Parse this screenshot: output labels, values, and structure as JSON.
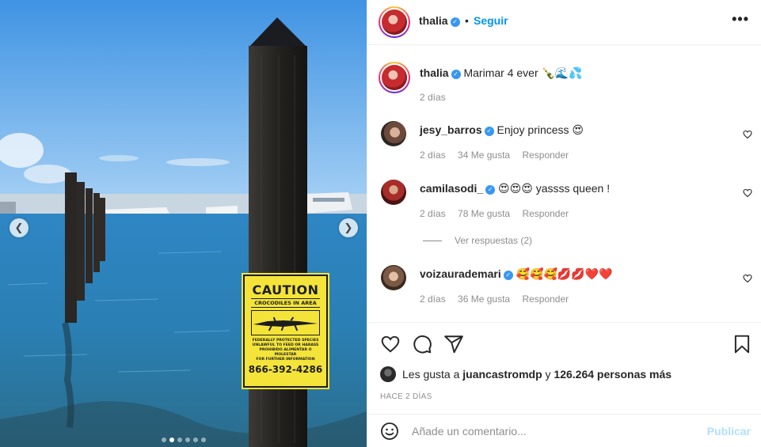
{
  "post": {
    "author": "thalia",
    "follow_label": "Seguir",
    "separator": "•",
    "more_label": "•••",
    "caption": {
      "username": "thalia",
      "text": "Marimar 4 ever 🍾🌊💦",
      "time": "2 días"
    }
  },
  "photo": {
    "sign": {
      "title": "CAUTION",
      "subtitle": "CROCODILES IN AREA",
      "line1": "FEDERALLY PROTECTED SPECIES",
      "line2": "UNLAWFUL TO FEED OR HARASS",
      "line3": "PROHIBIDO ALIMENTAR O MOLESTAR",
      "line4": "FOR FURTHER INFORMATION",
      "phone": "866-392-4286"
    },
    "carousel_count": 6,
    "carousel_active": 1
  },
  "comments": [
    {
      "username": "jesy_barros",
      "text": "Enjoy princess 😍",
      "time": "2 días",
      "likes": "34 Me gusta",
      "reply": "Responder"
    },
    {
      "username": "camilasodi_",
      "text": "😍😍😍 yassss queen !",
      "time": "2 días",
      "likes": "78 Me gusta",
      "reply": "Responder"
    },
    {
      "username": "voizaurademari",
      "text": "🥰🥰🥰💋💋❤️❤️",
      "time": "2 días",
      "likes": "36 Me gusta",
      "reply": "Responder"
    }
  ],
  "view_replies": "Ver respuestas (2)",
  "likes": {
    "prefix": "Les gusta a",
    "user": "juancastromdp",
    "connector": "y",
    "count_text": "126.264 personas más"
  },
  "timestamp": "HACE 2 DÍAS",
  "add_comment": {
    "placeholder": "Añade un comentario...",
    "publish_label": "Publicar"
  },
  "colors": {
    "link_blue": "#0095f6",
    "verified_blue": "#3897f0",
    "muted": "#8e8e8e",
    "publish_disabled": "#b2dffc"
  }
}
